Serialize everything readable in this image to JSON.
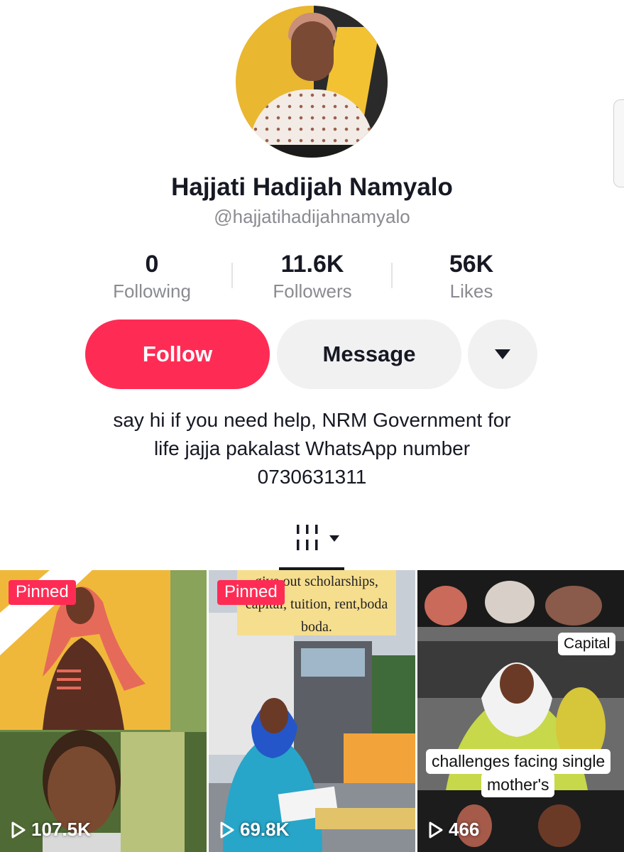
{
  "profile": {
    "name": "Hajjati Hadijah Namyalo",
    "handle": "@hajjatihadijahnamyalo"
  },
  "stats": [
    {
      "value": "0",
      "label": "Following"
    },
    {
      "value": "11.6K",
      "label": "Followers"
    },
    {
      "value": "56K",
      "label": "Likes"
    }
  ],
  "buttons": {
    "follow": "Follow",
    "message": "Message"
  },
  "bio": {
    "lines": [
      "say hi if you need help,  NRM Government for",
      "life jajja pakalast WhatsApp number",
      "0730631311"
    ]
  },
  "videos": [
    {
      "pinned": "Pinned",
      "views": "107.5K"
    },
    {
      "pinned": "Pinned",
      "views": "69.8K",
      "overlay_text": [
        "give out scholarships,",
        "capital, tuition, rent,boda",
        "boda."
      ]
    },
    {
      "views": "466",
      "caption_top": "Capital",
      "caption_main": [
        "challenges facing single",
        "mother's"
      ]
    }
  ],
  "colors": {
    "accent": "#fe2c55",
    "text": "#161823",
    "muted": "#8a8b91"
  }
}
